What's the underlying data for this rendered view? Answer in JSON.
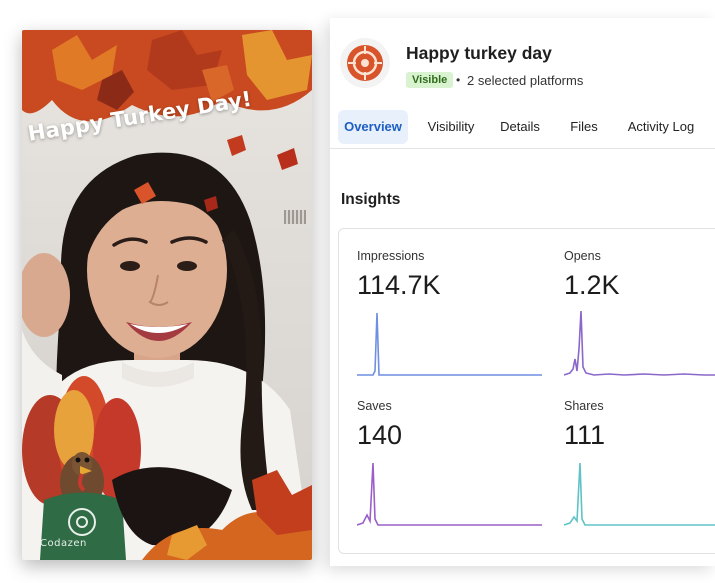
{
  "photo": {
    "overlay_text": "Happy Turkey Day!",
    "brand_text": "Codazen"
  },
  "header": {
    "title": "Happy turkey day",
    "status_badge": "Visible",
    "separator": "•",
    "platforms": "2 selected platforms",
    "icon": "target-logo-icon"
  },
  "tabs": [
    {
      "label": "Overview",
      "active": true
    },
    {
      "label": "Visibility",
      "active": false
    },
    {
      "label": "Details",
      "active": false
    },
    {
      "label": "Files",
      "active": false
    },
    {
      "label": "Activity Log",
      "active": false
    }
  ],
  "insights": {
    "title": "Insights",
    "metrics": [
      {
        "label": "Impressions",
        "value": "114.7K",
        "color": "#6f8fe0"
      },
      {
        "label": "Opens",
        "value": "1.2K",
        "color": "#8a67c9"
      },
      {
        "label": "Saves",
        "value": "140",
        "color": "#9a5fc8"
      },
      {
        "label": "Shares",
        "value": "111",
        "color": "#5ec3c6"
      }
    ]
  },
  "colors": {
    "active_tab": "#1d5fc2",
    "badge_bg": "#d9f2cf",
    "badge_text": "#2f6b1c"
  }
}
